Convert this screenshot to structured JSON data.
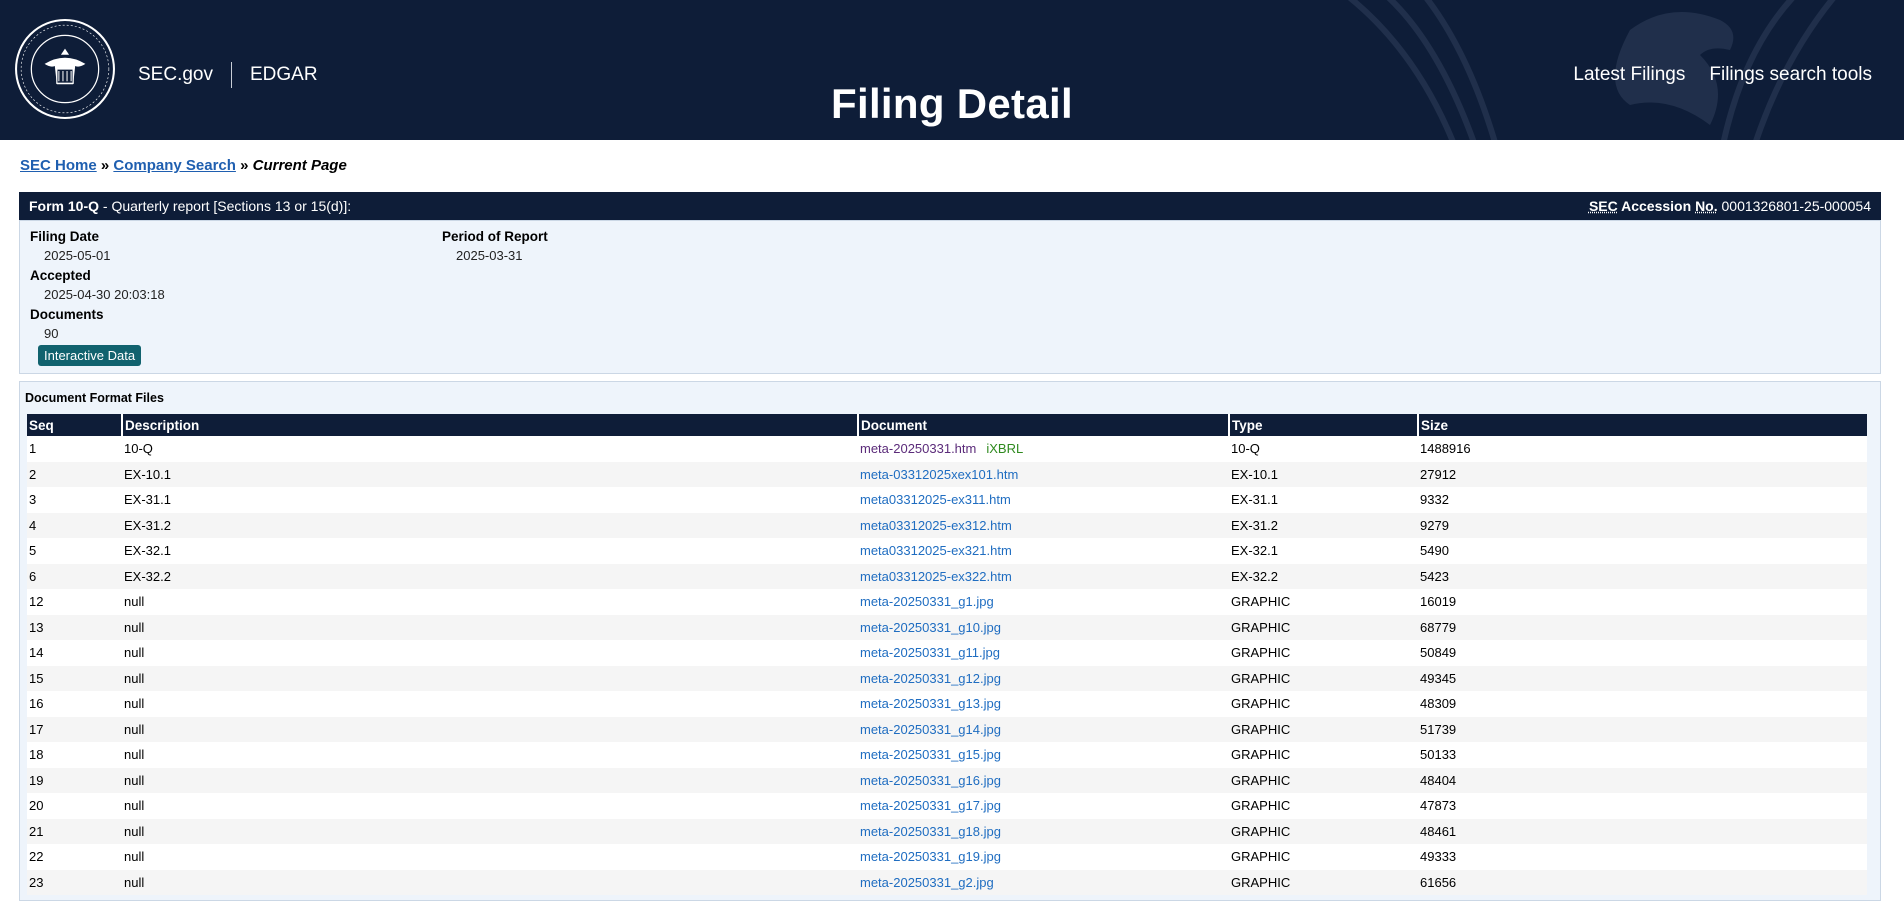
{
  "header": {
    "site_link": "SEC.gov",
    "edgar_link": "EDGAR",
    "title": "Filing Detail",
    "nav": [
      "Latest Filings",
      "Filings search tools"
    ]
  },
  "breadcrumb": {
    "home": "SEC Home",
    "sep1": "»",
    "company_search": "Company Search",
    "sep2": "»",
    "current": "Current Page"
  },
  "form": {
    "form_type": "Form 10-Q",
    "description": " - Quarterly report [Sections 13 or 15(d)]:",
    "accession_label_sec": "SEC",
    "accession_label_rest": "Accession",
    "accession_label_no": "No.",
    "accession_number": "0001326801-25-000054"
  },
  "info": {
    "filing_date_label": "Filing Date",
    "filing_date": "2025-05-01",
    "accepted_label": "Accepted",
    "accepted": "2025-04-30 20:03:18",
    "documents_label": "Documents",
    "documents": "90",
    "period_label": "Period of Report",
    "period": "2025-03-31",
    "interactive_button": "Interactive Data"
  },
  "documents_table": {
    "caption": "Document Format Files",
    "columns": [
      "Seq",
      "Description",
      "Document",
      "Type",
      "Size"
    ],
    "ixbrl_tag": "iXBRL",
    "rows": [
      {
        "seq": "1",
        "description": "10-Q",
        "document": "meta-20250331.htm",
        "type": "10-Q",
        "size": "1488916"
      },
      {
        "seq": "2",
        "description": "EX-10.1",
        "document": "meta-03312025xex101.htm",
        "type": "EX-10.1",
        "size": "27912"
      },
      {
        "seq": "3",
        "description": "EX-31.1",
        "document": "meta03312025-ex311.htm",
        "type": "EX-31.1",
        "size": "9332"
      },
      {
        "seq": "4",
        "description": "EX-31.2",
        "document": "meta03312025-ex312.htm",
        "type": "EX-31.2",
        "size": "9279"
      },
      {
        "seq": "5",
        "description": "EX-32.1",
        "document": "meta03312025-ex321.htm",
        "type": "EX-32.1",
        "size": "5490"
      },
      {
        "seq": "6",
        "description": "EX-32.2",
        "document": "meta03312025-ex322.htm",
        "type": "EX-32.2",
        "size": "5423"
      },
      {
        "seq": "12",
        "description": "null",
        "document": "meta-20250331_g1.jpg",
        "type": "GRAPHIC",
        "size": "16019"
      },
      {
        "seq": "13",
        "description": "null",
        "document": "meta-20250331_g10.jpg",
        "type": "GRAPHIC",
        "size": "68779"
      },
      {
        "seq": "14",
        "description": "null",
        "document": "meta-20250331_g11.jpg",
        "type": "GRAPHIC",
        "size": "50849"
      },
      {
        "seq": "15",
        "description": "null",
        "document": "meta-20250331_g12.jpg",
        "type": "GRAPHIC",
        "size": "49345"
      },
      {
        "seq": "16",
        "description": "null",
        "document": "meta-20250331_g13.jpg",
        "type": "GRAPHIC",
        "size": "48309"
      },
      {
        "seq": "17",
        "description": "null",
        "document": "meta-20250331_g14.jpg",
        "type": "GRAPHIC",
        "size": "51739"
      },
      {
        "seq": "18",
        "description": "null",
        "document": "meta-20250331_g15.jpg",
        "type": "GRAPHIC",
        "size": "50133"
      },
      {
        "seq": "19",
        "description": "null",
        "document": "meta-20250331_g16.jpg",
        "type": "GRAPHIC",
        "size": "48404"
      },
      {
        "seq": "20",
        "description": "null",
        "document": "meta-20250331_g17.jpg",
        "type": "GRAPHIC",
        "size": "47873"
      },
      {
        "seq": "21",
        "description": "null",
        "document": "meta-20250331_g18.jpg",
        "type": "GRAPHIC",
        "size": "48461"
      },
      {
        "seq": "22",
        "description": "null",
        "document": "meta-20250331_g19.jpg",
        "type": "GRAPHIC",
        "size": "49333"
      },
      {
        "seq": "23",
        "description": "null",
        "document": "meta-20250331_g2.jpg",
        "type": "GRAPHIC",
        "size": "61656"
      }
    ]
  },
  "colors": {
    "navy": "#0e1d38",
    "link": "#1f6dc1",
    "visited_link": "#5b2b7a",
    "ixbrl": "#2f8a1f",
    "button": "#11626e",
    "panel": "#eef4fb"
  },
  "icons": {
    "seal": "sec-seal-icon",
    "watermark": "eagle-watermark"
  }
}
